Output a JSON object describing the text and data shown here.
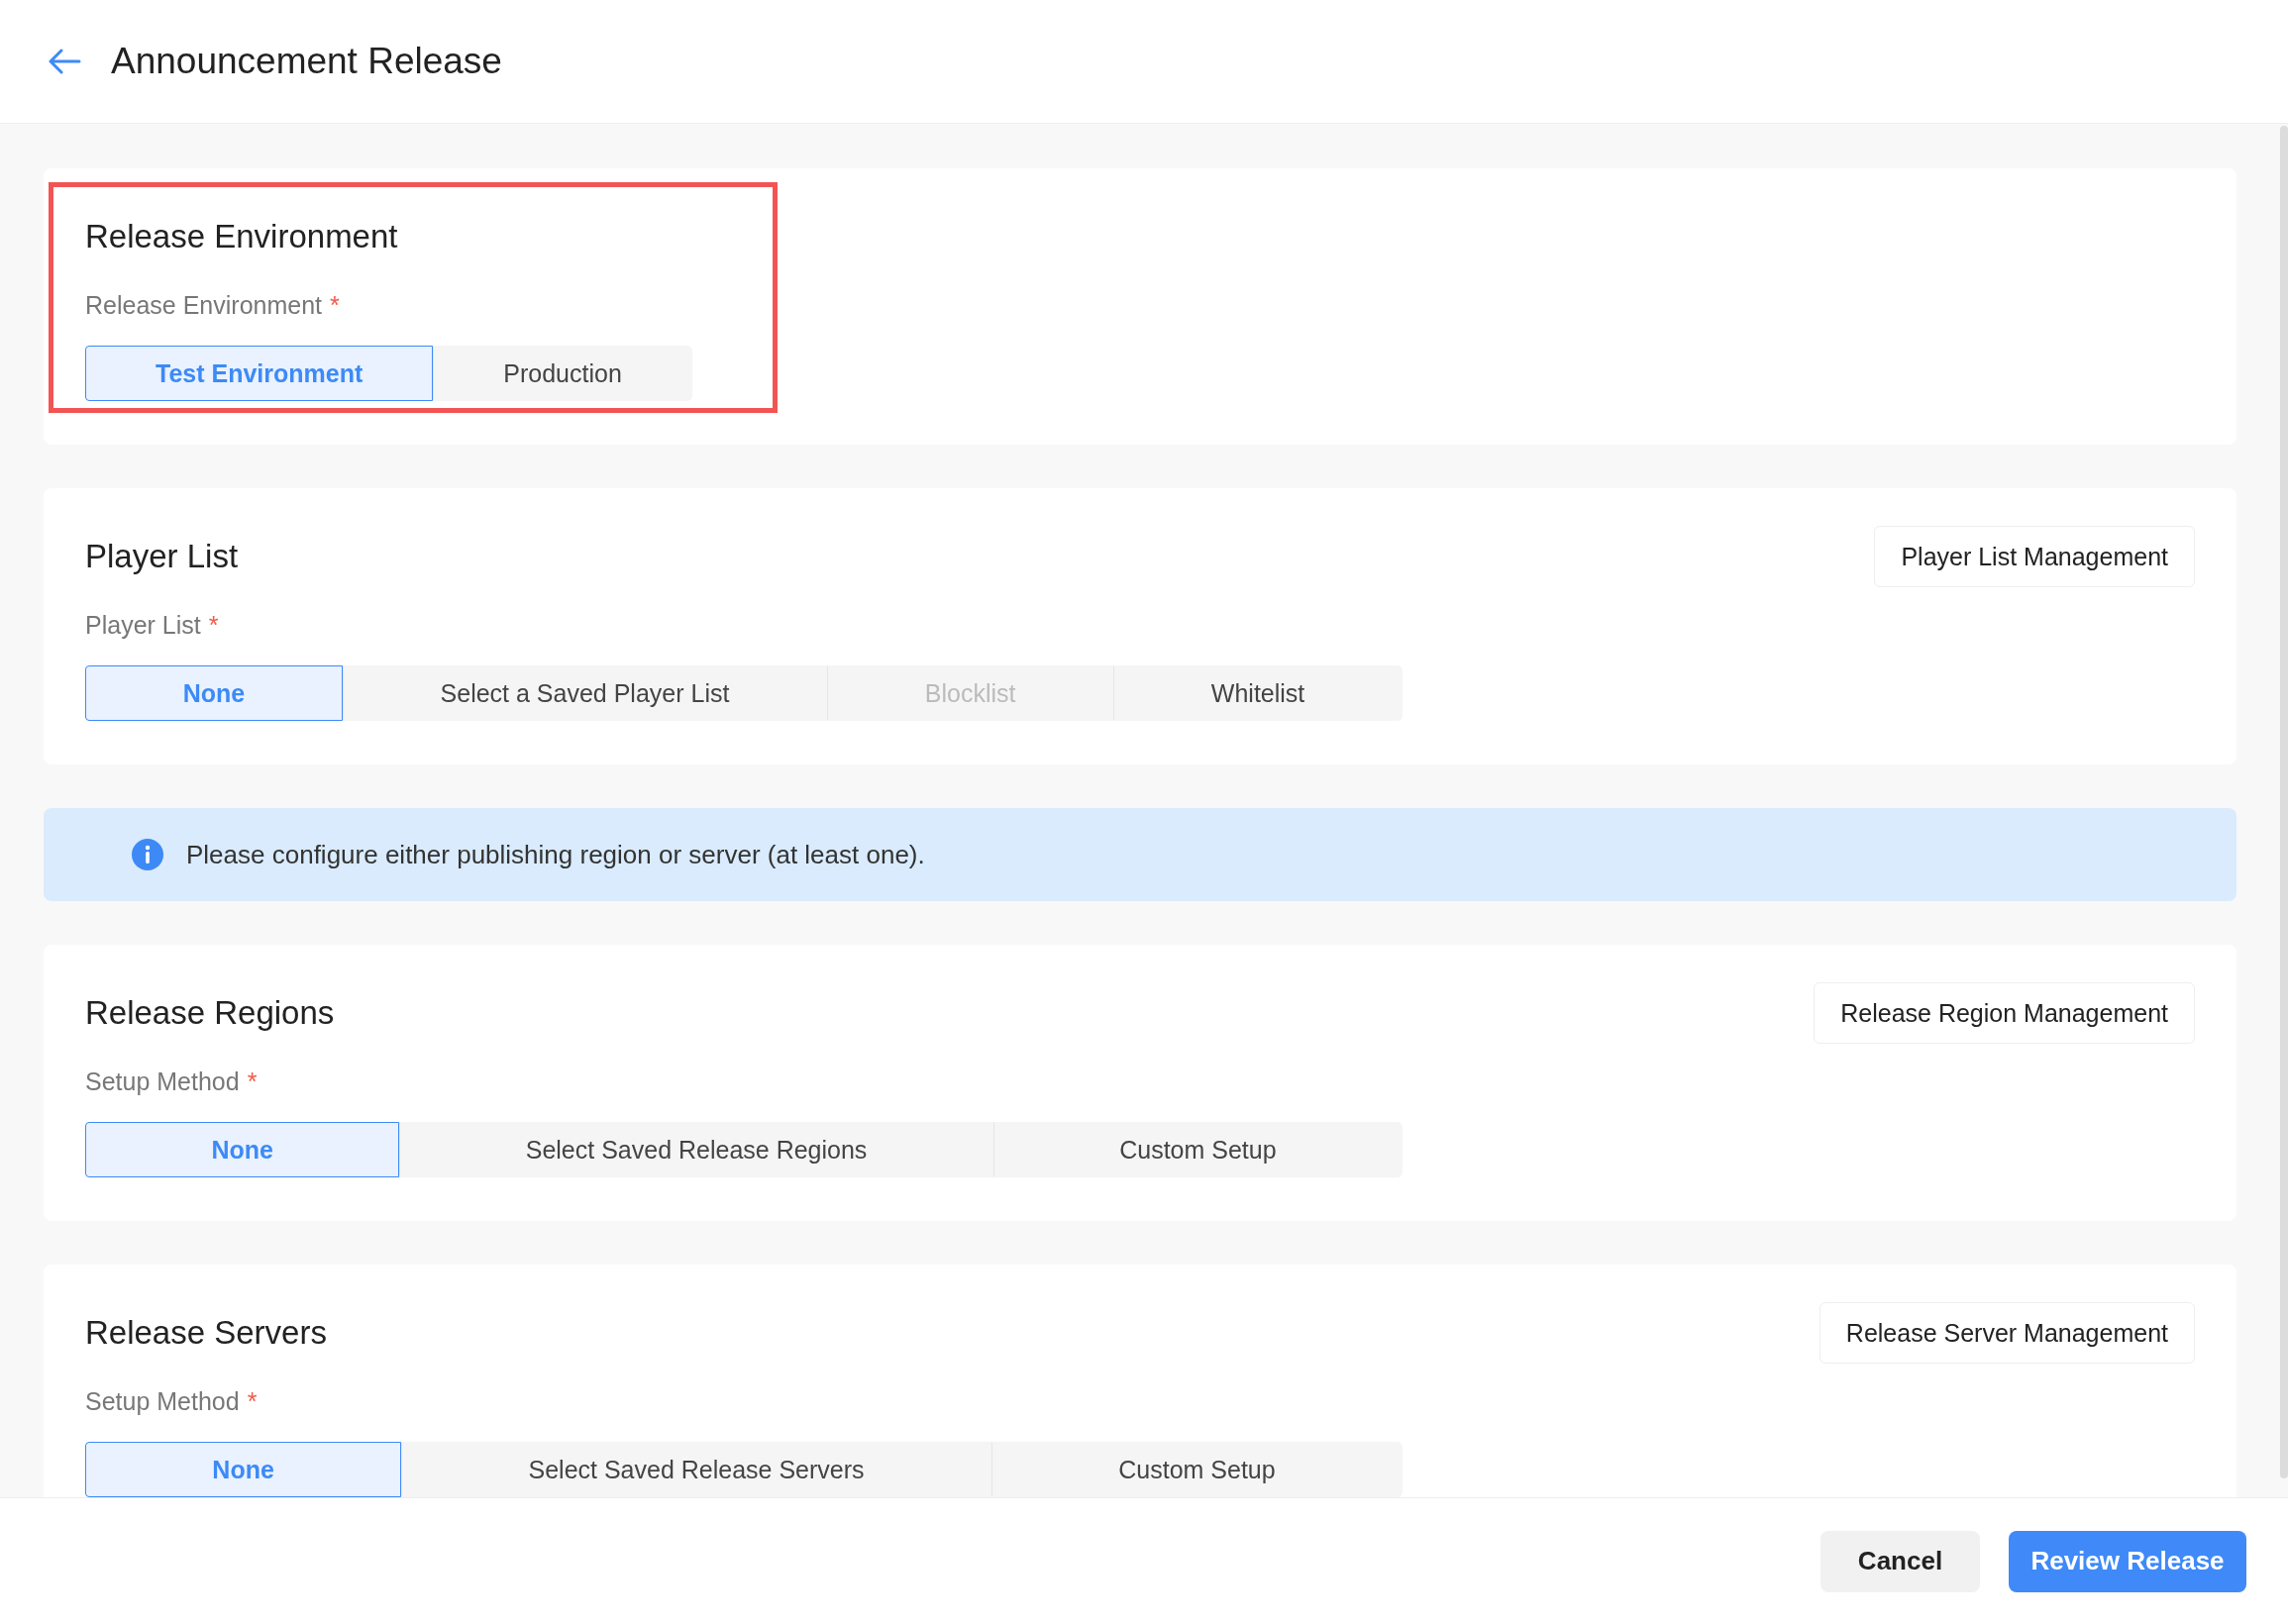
{
  "header": {
    "title": "Announcement Release"
  },
  "sections": [
    {
      "kind": "card",
      "title": "Release Environment",
      "highlighted": true,
      "field": {
        "label": "Release Environment",
        "required_mark": "*"
      },
      "options": [
        {
          "label": "Test Environment",
          "selected": true,
          "disabled": false
        },
        {
          "label": "Production",
          "selected": false,
          "disabled": false
        }
      ]
    },
    {
      "kind": "card",
      "title": "Player List",
      "action": "Player List Management",
      "highlighted": false,
      "field": {
        "label": "Player List",
        "required_mark": "*"
      },
      "options": [
        {
          "label": "None",
          "selected": true,
          "disabled": false
        },
        {
          "label": "Select a Saved Player List",
          "selected": false,
          "disabled": false
        },
        {
          "label": "Blocklist",
          "selected": false,
          "disabled": true
        },
        {
          "label": "Whitelist",
          "selected": false,
          "disabled": false
        }
      ]
    },
    {
      "kind": "notice",
      "text": "Please configure either publishing region or server (at least one)."
    },
    {
      "kind": "card",
      "title": "Release Regions",
      "action": "Release Region Management",
      "highlighted": false,
      "field": {
        "label": "Setup Method",
        "required_mark": "*"
      },
      "options": [
        {
          "label": "None",
          "selected": true,
          "disabled": false
        },
        {
          "label": "Select Saved Release Regions",
          "selected": false,
          "disabled": false
        },
        {
          "label": "Custom Setup",
          "selected": false,
          "disabled": false
        }
      ]
    },
    {
      "kind": "card",
      "title": "Release Servers",
      "action": "Release Server Management",
      "highlighted": false,
      "field": {
        "label": "Setup Method",
        "required_mark": "*"
      },
      "options": [
        {
          "label": "None",
          "selected": true,
          "disabled": false
        },
        {
          "label": "Select Saved Release Servers",
          "selected": false,
          "disabled": false
        },
        {
          "label": "Custom Setup",
          "selected": false,
          "disabled": false
        }
      ]
    }
  ],
  "footer": {
    "buttons": [
      {
        "label": "Cancel",
        "kind": "secondary"
      },
      {
        "label": "Review Release",
        "kind": "primary"
      }
    ]
  }
}
